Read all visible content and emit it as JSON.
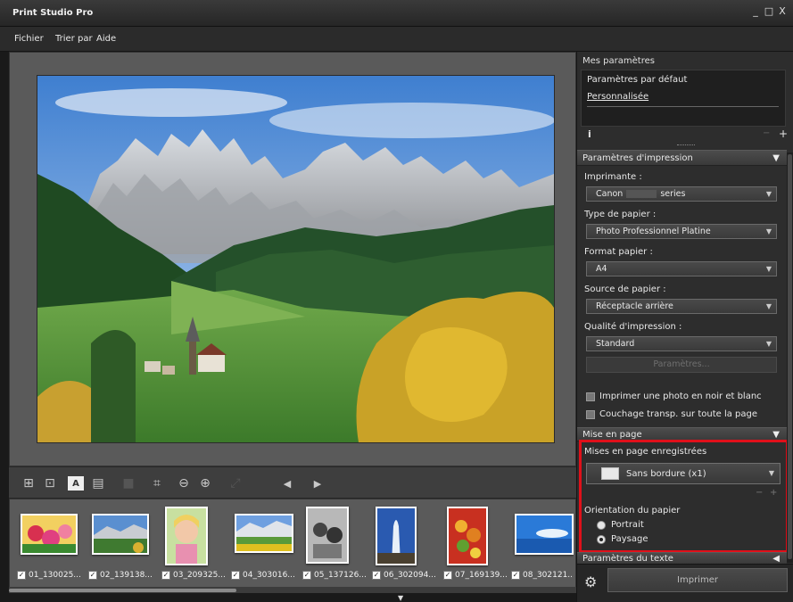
{
  "window": {
    "title": "Print Studio Pro",
    "controls": [
      "_",
      "□",
      "X"
    ]
  },
  "menu": [
    {
      "label": "Fichier"
    },
    {
      "label": "Trier par"
    },
    {
      "label": "Aide"
    }
  ],
  "filmstrip": [
    {
      "label": "01_130025...",
      "checked": true
    },
    {
      "label": "02_139138...",
      "checked": true
    },
    {
      "label": "03_209325...",
      "checked": true
    },
    {
      "label": "04_303016...",
      "checked": true
    },
    {
      "label": "05_137126...",
      "checked": true
    },
    {
      "label": "06_302094...",
      "checked": true
    },
    {
      "label": "07_169139...",
      "checked": true
    },
    {
      "label": "08_302121...",
      "checked": true
    }
  ],
  "panel": {
    "my_settings": {
      "title": "Mes paramètres",
      "items": [
        "Paramètres par défaut",
        "Personnalisée"
      ],
      "info": "i",
      "minus": "−",
      "plus": "+"
    },
    "print_settings": {
      "header": "Paramètres d'impression",
      "printer_label": "Imprimante :",
      "printer_value_prefix": "Canon",
      "printer_value_suffix": "series",
      "paper_type_label": "Type de papier :",
      "paper_type_value": "Photo Professionnel Platine",
      "paper_size_label": "Format papier :",
      "paper_size_value": "A4",
      "paper_source_label": "Source de papier :",
      "paper_source_value": "Réceptacle arrière",
      "quality_label": "Qualité d'impression :",
      "quality_value": "Standard",
      "settings_button": "Paramètres...",
      "bw_checkbox": "Imprimer une photo en noir et blanc",
      "coating_checkbox": "Couchage transp. sur toute la page"
    },
    "layout": {
      "header": "Mise en page",
      "saved_layouts_label": "Mises en page enregistrées",
      "saved_layouts_value": "Sans bordure (x1)",
      "orientation_label": "Orientation du papier",
      "portrait": "Portrait",
      "landscape": "Paysage",
      "selected_orientation": "landscape"
    },
    "text_settings": {
      "header": "Paramètres du texte"
    },
    "print_button": "Imprimer"
  },
  "colors": {
    "highlight": "#e0101a",
    "panel_bg": "#2d2d2d",
    "viewer_bg": "#5a5a5a"
  },
  "icons": [
    "fit-page-icon",
    "actual-size-icon",
    "add-text-icon",
    "add-image-icon",
    "crop-icon",
    "zoom-out-icon",
    "zoom-in-icon",
    "prev-arrow-icon",
    "next-arrow-icon",
    "gear-icon"
  ]
}
